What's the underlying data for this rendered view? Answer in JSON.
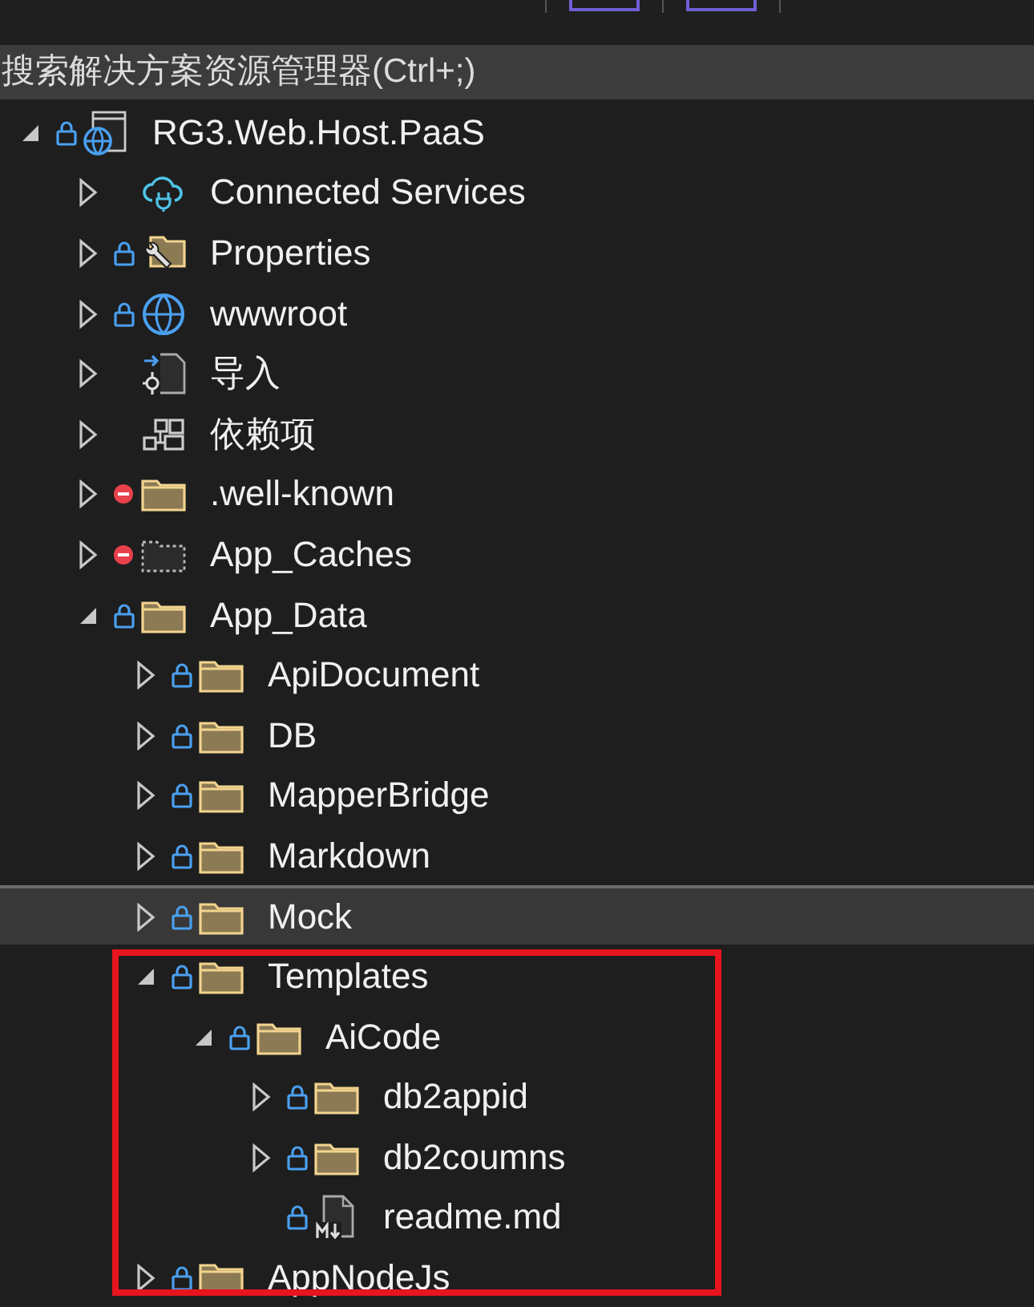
{
  "toolbar": {
    "buttons": [
      {
        "selected": true
      },
      {
        "selected": true
      }
    ]
  },
  "search": {
    "placeholder": "搜索解决方案资源管理器(Ctrl+;)"
  },
  "tree": [
    {
      "label": "RG3.Web.Host.PaaS",
      "kind": "web-project",
      "locked": true,
      "excluded": false,
      "has_children": true,
      "expanded": true,
      "selected": false,
      "children": [
        {
          "label": "Connected Services",
          "kind": "connected",
          "locked": false,
          "excluded": false,
          "has_children": true,
          "expanded": false,
          "selected": false
        },
        {
          "label": "Properties",
          "kind": "properties",
          "locked": true,
          "excluded": false,
          "has_children": true,
          "expanded": false,
          "selected": false
        },
        {
          "label": "wwwroot",
          "kind": "globe",
          "locked": true,
          "excluded": false,
          "has_children": true,
          "expanded": false,
          "selected": false
        },
        {
          "label": "导入",
          "kind": "import",
          "locked": false,
          "excluded": false,
          "has_children": true,
          "expanded": false,
          "selected": false
        },
        {
          "label": "依赖项",
          "kind": "dependencies",
          "locked": false,
          "excluded": false,
          "has_children": true,
          "expanded": false,
          "selected": false
        },
        {
          "label": ".well-known",
          "kind": "folder",
          "locked": false,
          "excluded": true,
          "has_children": true,
          "expanded": false,
          "selected": false
        },
        {
          "label": "App_Caches",
          "kind": "missing-folder",
          "locked": false,
          "excluded": true,
          "has_children": true,
          "expanded": false,
          "selected": false
        },
        {
          "label": "App_Data",
          "kind": "folder",
          "locked": true,
          "excluded": false,
          "has_children": true,
          "expanded": true,
          "selected": false,
          "children": [
            {
              "label": "ApiDocument",
              "kind": "folder",
              "locked": true,
              "excluded": false,
              "has_children": true,
              "expanded": false,
              "selected": false
            },
            {
              "label": "DB",
              "kind": "folder",
              "locked": true,
              "excluded": false,
              "has_children": true,
              "expanded": false,
              "selected": false
            },
            {
              "label": "MapperBridge",
              "kind": "folder",
              "locked": true,
              "excluded": false,
              "has_children": true,
              "expanded": false,
              "selected": false
            },
            {
              "label": "Markdown",
              "kind": "folder",
              "locked": true,
              "excluded": false,
              "has_children": true,
              "expanded": false,
              "selected": false
            },
            {
              "label": "Mock",
              "kind": "folder",
              "locked": true,
              "excluded": false,
              "has_children": true,
              "expanded": false,
              "selected": true
            },
            {
              "label": "Templates",
              "kind": "folder",
              "locked": true,
              "excluded": false,
              "has_children": true,
              "expanded": true,
              "selected": false,
              "children": [
                {
                  "label": "AiCode",
                  "kind": "folder",
                  "locked": true,
                  "excluded": false,
                  "has_children": true,
                  "expanded": true,
                  "selected": false,
                  "children": [
                    {
                      "label": "db2appid",
                      "kind": "folder",
                      "locked": true,
                      "excluded": false,
                      "has_children": true,
                      "expanded": false,
                      "selected": false
                    },
                    {
                      "label": "db2coumns",
                      "kind": "folder",
                      "locked": true,
                      "excluded": false,
                      "has_children": true,
                      "expanded": false,
                      "selected": false
                    },
                    {
                      "label": "readme.md",
                      "kind": "markdown-file",
                      "locked": true,
                      "excluded": false,
                      "has_children": false,
                      "selected": false
                    }
                  ]
                }
              ]
            },
            {
              "label": "AppNodeJs",
              "kind": "folder",
              "locked": true,
              "excluded": false,
              "has_children": true,
              "expanded": false,
              "selected": false
            }
          ]
        }
      ]
    }
  ]
}
